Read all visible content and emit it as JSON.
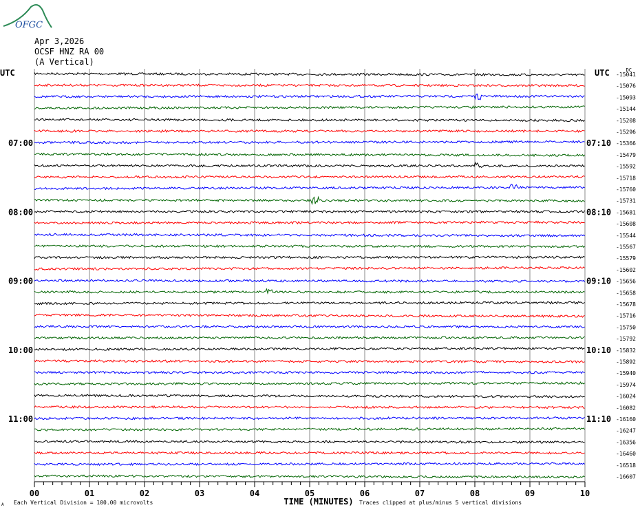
{
  "logo_text": "OFGC",
  "header": {
    "date": "Apr 3,2026",
    "station": "OCSF HNZ RA 00",
    "component": "(A Vertical)"
  },
  "chart_data": {
    "type": "line",
    "title": "OCSF HNZ RA 00 (A Vertical) Apr 3,2026",
    "xlabel": "TIME (MINUTES)",
    "xlim": [
      0,
      10
    ],
    "x_ticks": [
      "00",
      "01",
      "02",
      "03",
      "04",
      "05",
      "06",
      "07",
      "08",
      "09",
      "10"
    ],
    "left_axis_title": "UTC",
    "right_axis_title": "UTC",
    "dc_label": "DC",
    "left_time_labels": [
      {
        "row": 6,
        "label": "07:00"
      },
      {
        "row": 12,
        "label": "08:00"
      },
      {
        "row": 18,
        "label": "09:00"
      },
      {
        "row": 24,
        "label": "10:00"
      },
      {
        "row": 30,
        "label": "11:00"
      }
    ],
    "right_time_labels": [
      {
        "row": 6,
        "label": "07:10"
      },
      {
        "row": 12,
        "label": "08:10"
      },
      {
        "row": 18,
        "label": "09:10"
      },
      {
        "row": 24,
        "label": "10:10"
      },
      {
        "row": 30,
        "label": "11:10"
      }
    ],
    "dc_offsets": [
      -15041,
      -15076,
      -15093,
      -15144,
      -15208,
      -15296,
      -15366,
      -15479,
      -15592,
      -15718,
      -15760,
      -15731,
      -15681,
      -15608,
      -15544,
      -15567,
      -15579,
      -15602,
      -15656,
      -15658,
      -15678,
      -15716,
      -15750,
      -15792,
      -15832,
      -15892,
      -15940,
      -15974,
      -16024,
      -16082,
      -16160,
      -16247,
      -16356,
      -16460,
      -16518,
      -16607
    ],
    "trace_colors": [
      "#000000",
      "#ff0000",
      "#0000ff",
      "#006400"
    ],
    "events": [
      {
        "row": 2,
        "minute": 8.05
      },
      {
        "row": 8,
        "minute": 8.05
      },
      {
        "row": 10,
        "minute": 8.7
      },
      {
        "row": 11,
        "minute": 5.1
      },
      {
        "row": 19,
        "minute": 4.27
      }
    ],
    "footer_left": "Each Vertical Division =  100.00 microvolts",
    "footer_right": "Traces clipped at plus/minus 5 vertical divisions",
    "corner_mark": "A"
  }
}
